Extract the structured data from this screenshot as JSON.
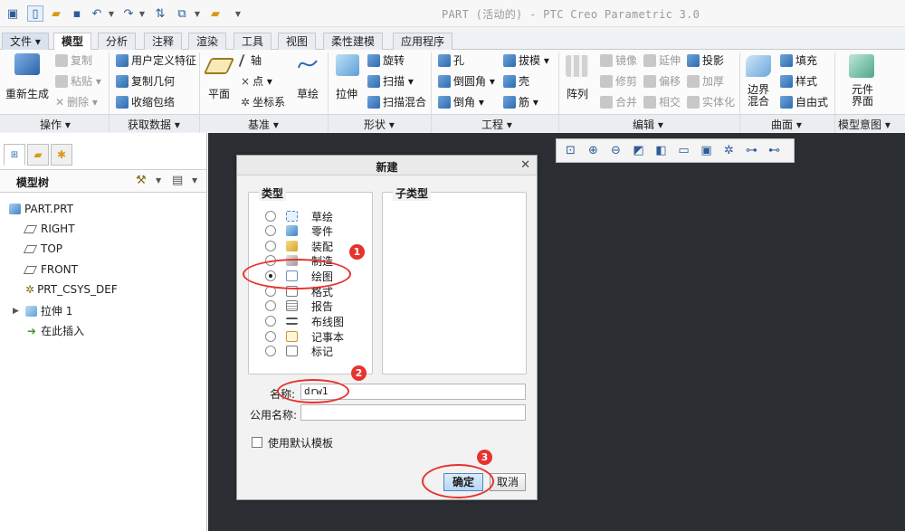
{
  "window": {
    "title": "PART (活动的) - PTC Creo Parametric 3.0"
  },
  "tabs": [
    {
      "label": "文件"
    },
    {
      "label": "模型"
    },
    {
      "label": "分析"
    },
    {
      "label": "注释"
    },
    {
      "label": "渲染"
    },
    {
      "label": "工具"
    },
    {
      "label": "视图"
    },
    {
      "label": "柔性建模"
    },
    {
      "label": "应用程序"
    }
  ],
  "ribbon": {
    "regen": "重新生成",
    "copy": "复制",
    "paste": "粘贴",
    "delete": "删除",
    "udf": "用户定义特征",
    "copy_geom": "复制几何",
    "shrinkwrap": "收缩包络",
    "plane": "平面",
    "axis": "轴",
    "point": "点",
    "csys": "坐标系",
    "sketch": "草绘",
    "extrude": "拉伸",
    "revolve": "旋转",
    "sweep": "扫描",
    "swept_blend": "扫描混合",
    "hole": "孔",
    "round": "倒圆角",
    "chamfer": "倒角",
    "draft": "拔模",
    "shell": "壳",
    "rib": "筋",
    "pattern": "阵列",
    "mirror": "镜像",
    "trim": "修剪",
    "merge": "合并",
    "extend": "延伸",
    "offset": "偏移",
    "intersect": "相交",
    "project": "投影",
    "thicken": "加厚",
    "solidify": "实体化",
    "boundary_blend": "边界混合",
    "fill": "填充",
    "style": "样式",
    "freestyle": "自由式",
    "component_interface": "元件界面"
  },
  "groups": {
    "operations": "操作",
    "get_data": "获取数据",
    "datum": "基准",
    "shapes": "形状",
    "engineering": "工程",
    "editing": "编辑",
    "surfaces": "曲面",
    "model_intent": "模型意图"
  },
  "model_tree": {
    "title": "模型树",
    "items": [
      {
        "label": "PART.PRT"
      },
      {
        "label": "RIGHT"
      },
      {
        "label": "TOP"
      },
      {
        "label": "FRONT"
      },
      {
        "label": "PRT_CSYS_DEF"
      },
      {
        "label": "拉伸 1"
      },
      {
        "label": "在此插入"
      }
    ]
  },
  "dialog": {
    "title": "新建",
    "type_label": "类型",
    "subtype_label": "子类型",
    "types": [
      {
        "label": "草绘",
        "selected": false
      },
      {
        "label": "零件",
        "selected": false
      },
      {
        "label": "装配",
        "selected": false
      },
      {
        "label": "制造",
        "selected": false
      },
      {
        "label": "绘图",
        "selected": true
      },
      {
        "label": "格式",
        "selected": false
      },
      {
        "label": "报告",
        "selected": false
      },
      {
        "label": "布线图",
        "selected": false
      },
      {
        "label": "记事本",
        "selected": false
      },
      {
        "label": "标记",
        "selected": false
      }
    ],
    "name_label": "名称:",
    "name_value": "drw1",
    "common_name_label": "公用名称:",
    "common_name_value": "",
    "use_default_template": "使用默认模板",
    "use_default_checked": false,
    "ok": "确定",
    "cancel": "取消"
  },
  "annotations": [
    "1",
    "2",
    "3"
  ],
  "colors": {
    "accent": "#e8322e",
    "graphics_bg": "#2b2f33",
    "ok_button": "#b7d5f3"
  }
}
